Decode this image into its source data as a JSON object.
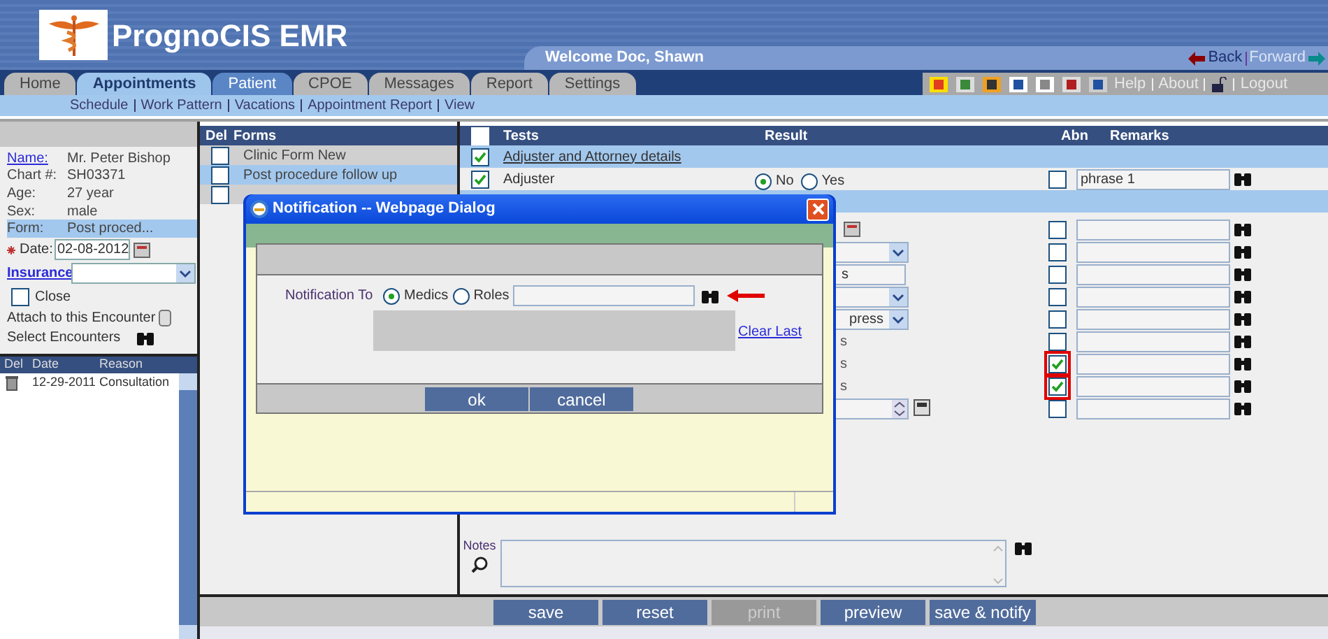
{
  "app": {
    "title": "PrognoCIS EMR",
    "welcome": "Welcome Doc, Shawn",
    "back": "Back",
    "forward": "Forward"
  },
  "tabs": [
    {
      "label": "Home",
      "selected": false
    },
    {
      "label": "Appointments",
      "selected": false,
      "hover": true
    },
    {
      "label": "Patient",
      "selected": true
    },
    {
      "label": "CPOE",
      "selected": false
    },
    {
      "label": "Messages",
      "selected": false
    },
    {
      "label": "Report",
      "selected": false
    },
    {
      "label": "Settings",
      "selected": false
    }
  ],
  "top_links": [
    "Help",
    "About",
    "Logout"
  ],
  "sub_nav": [
    "Schedule",
    "Work Pattern",
    "Vacations",
    "Appointment Report",
    "View"
  ],
  "patient": {
    "fields": [
      {
        "label": "Name:",
        "value": "Mr. Peter Bishop",
        "link": true
      },
      {
        "label": "Chart #:",
        "value": "SH03371"
      },
      {
        "label": "Age:",
        "value": "27 year"
      },
      {
        "label": "Sex:",
        "value": "male"
      },
      {
        "label": "Form:",
        "value": "Post proced...",
        "selected": true
      }
    ],
    "date_label": "Date:",
    "date": "02-08-2012",
    "insurance_label": "Insurance",
    "close_label": "Close",
    "close_checked": false,
    "attach_label": "Attach to this Encounter",
    "select_label": "Select Encounters"
  },
  "encounters": {
    "columns": [
      "Del",
      "Date",
      "Reason"
    ],
    "rows": [
      {
        "date": "12-29-2011",
        "reason": "Consultation"
      }
    ]
  },
  "forms": {
    "columns": [
      "Del",
      "Forms"
    ],
    "rows": [
      {
        "label": "Clinic Form New",
        "selected": false
      },
      {
        "label": "Post procedure follow up",
        "selected": true
      },
      {
        "selected": false
      }
    ]
  },
  "tests": {
    "header_checked": false,
    "columns": [
      "Tests",
      "Result",
      "Abn",
      "Remarks"
    ],
    "rows": [
      {
        "kind": "group",
        "label": "Adjuster and Attorney details",
        "checked": true
      },
      {
        "kind": "radio",
        "label": "Adjuster",
        "checked": true,
        "options": [
          {
            "label": "No",
            "selected": true
          },
          {
            "label": "Yes",
            "selected": false
          }
        ],
        "abn": false,
        "remark": "phrase 1"
      },
      {
        "kind": "group"
      },
      {
        "kind": "date",
        "abn": false
      },
      {
        "kind": "select",
        "abn": false
      },
      {
        "kind": "text",
        "value": "s",
        "abn": false
      },
      {
        "kind": "select",
        "abn": false
      },
      {
        "kind": "select",
        "value": "press",
        "abn": false
      },
      {
        "kind": "plain",
        "tail": "s",
        "abn": false
      },
      {
        "kind": "plain",
        "tail": "s",
        "abn": true,
        "highlighted": true
      },
      {
        "kind": "plain",
        "tail": "s",
        "abn": true,
        "highlighted": true
      },
      {
        "kind": "spinner",
        "abn": false
      }
    ]
  },
  "notes_label": "Notes",
  "buttons": [
    {
      "label": "save",
      "disabled": false
    },
    {
      "label": "reset",
      "disabled": false
    },
    {
      "label": "print",
      "disabled": true
    },
    {
      "label": "preview",
      "disabled": false
    },
    {
      "label": "save & notify",
      "disabled": false
    }
  ],
  "dialog": {
    "title": "Notification -- Webpage Dialog",
    "label": "Notification To",
    "options": [
      {
        "label": "Medics",
        "selected": true
      },
      {
        "label": "Roles",
        "selected": false
      }
    ],
    "clear": "Clear Last",
    "buttons": [
      "ok",
      "cancel"
    ]
  }
}
